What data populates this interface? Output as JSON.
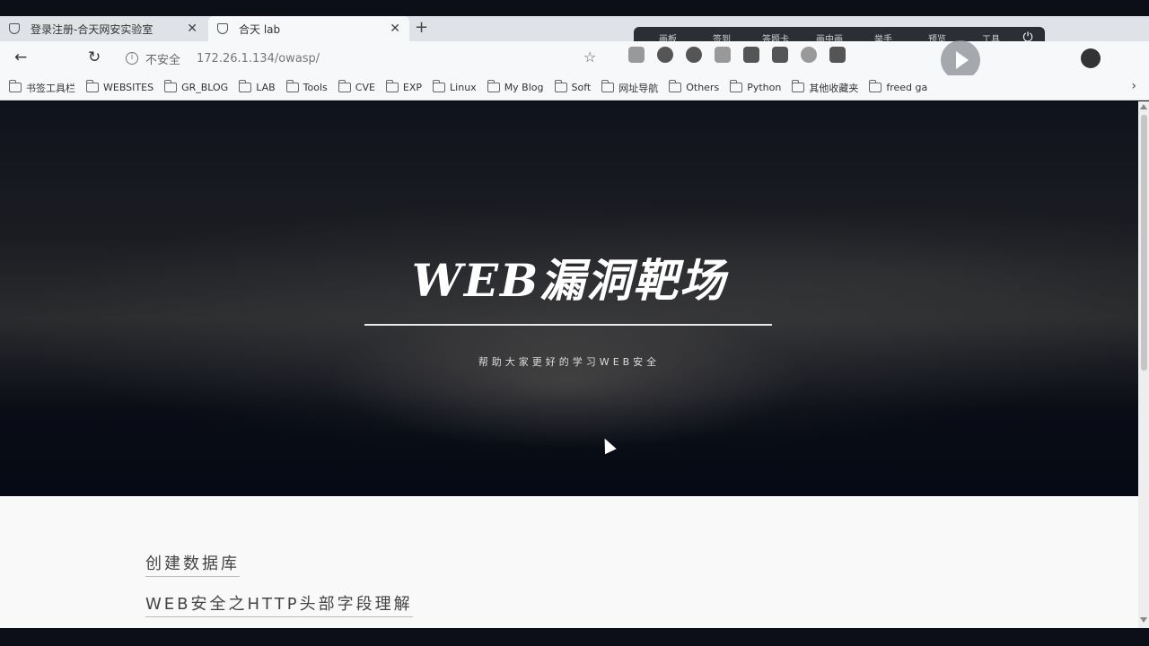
{
  "tabs": [
    {
      "title": "登录注册-合天网安实验室",
      "icon": "shield-icon"
    },
    {
      "title": "合天 lab",
      "icon": "shield-icon"
    }
  ],
  "overlay_toolbar": [
    "画板",
    "签到",
    "答题卡",
    "画中画",
    "举手",
    "预览",
    "工具"
  ],
  "address": {
    "security_label": "不安全",
    "url": "172.26.1.134/owasp/"
  },
  "bookmarks": [
    "书签工具栏",
    "WEBSITES",
    "GR_BLOG",
    "LAB",
    "Tools",
    "CVE",
    "EXP",
    "Linux",
    "My Blog",
    "Soft",
    "网址导航",
    "Others",
    "Python",
    "其他收藏夹",
    "freed ga"
  ],
  "hero": {
    "title": "WEB漏洞靶场",
    "subtitle": "帮助大家更好的学习WEB安全"
  },
  "articles": [
    "创建数据库",
    "WEB安全之HTTP头部字段理解"
  ]
}
